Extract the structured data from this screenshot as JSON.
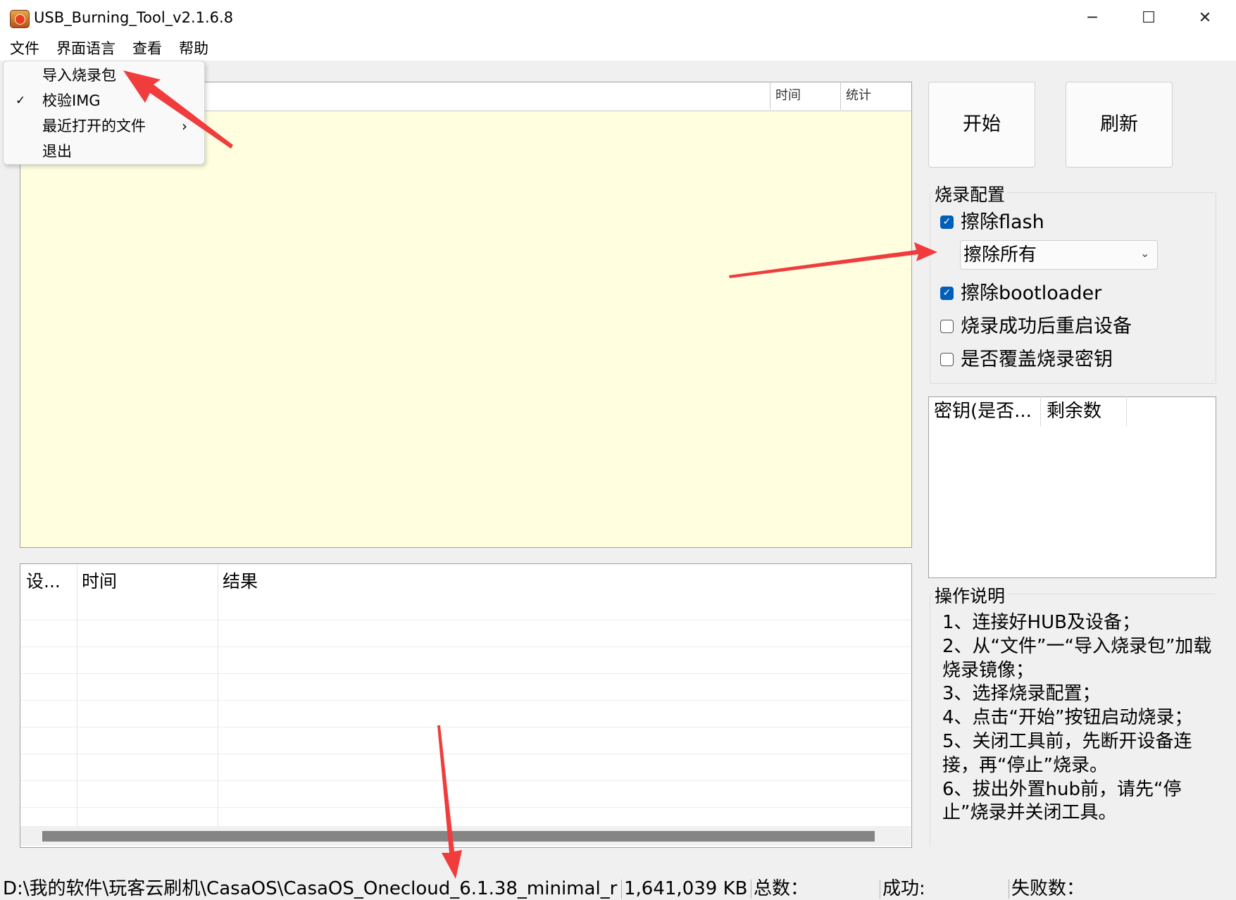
{
  "window": {
    "title": "USB_Burning_Tool_v2.1.6.8",
    "controls": {
      "minimize": "─",
      "maximize": "☐",
      "close": "✕"
    }
  },
  "menubar": [
    "文件",
    "界面语言",
    "查看",
    "帮助"
  ],
  "file_menu": {
    "items": [
      {
        "label": "导入烧录包",
        "checked": false,
        "submenu": false
      },
      {
        "label": "校验IMG",
        "checked": true,
        "submenu": false
      },
      {
        "label": "最近打开的文件",
        "checked": false,
        "submenu": true
      },
      {
        "label": "退出",
        "checked": false,
        "submenu": false
      }
    ],
    "check_glyph": "✓",
    "submenu_glyph": "›"
  },
  "device_list": {
    "columns": [
      "时间",
      "统计"
    ]
  },
  "log_table": {
    "columns": [
      "设...",
      "时间",
      "结果"
    ],
    "rows": []
  },
  "buttons": {
    "start": "开始",
    "refresh": "刷新"
  },
  "burn_config": {
    "title": "烧录配置",
    "erase_flash": {
      "label": "擦除flash",
      "checked": true
    },
    "erase_mode": {
      "value": "擦除所有",
      "chevron": "⌄"
    },
    "erase_bootloader": {
      "label": "擦除bootloader",
      "checked": true
    },
    "reboot_after": {
      "label": "烧录成功后重启设备",
      "checked": false
    },
    "overwrite_key": {
      "label": "是否覆盖烧录密钥",
      "checked": false
    },
    "check_glyph": "✓"
  },
  "key_list": {
    "columns": [
      "密钥(是否...",
      "剩余数"
    ]
  },
  "instructions": {
    "title": "操作说明",
    "text": "1、连接好HUB及设备；\n2、从“文件”一“导入烧录包”加载烧录镜像；\n3、选择烧录配置；\n4、点击“开始”按钮启动烧录；\n5、关闭工具前，先断开设备连接，再“停止”烧录。\n6、拔出外置hub前，请先“停止”烧录并关闭工具。"
  },
  "statusbar": {
    "path": "D:\\我的软件\\玩客云刷机\\CasaOS\\CasaOS_Onecloud_6.1.38_minimal_r",
    "size": "1,641,039 KB",
    "total": "总数：",
    "success": "成功:",
    "failed": "失败数："
  },
  "colors": {
    "device_area_bg": "#ffffe0",
    "checkbox_checked": "#005fb8",
    "annotation_arrow": "#f03c3c"
  }
}
